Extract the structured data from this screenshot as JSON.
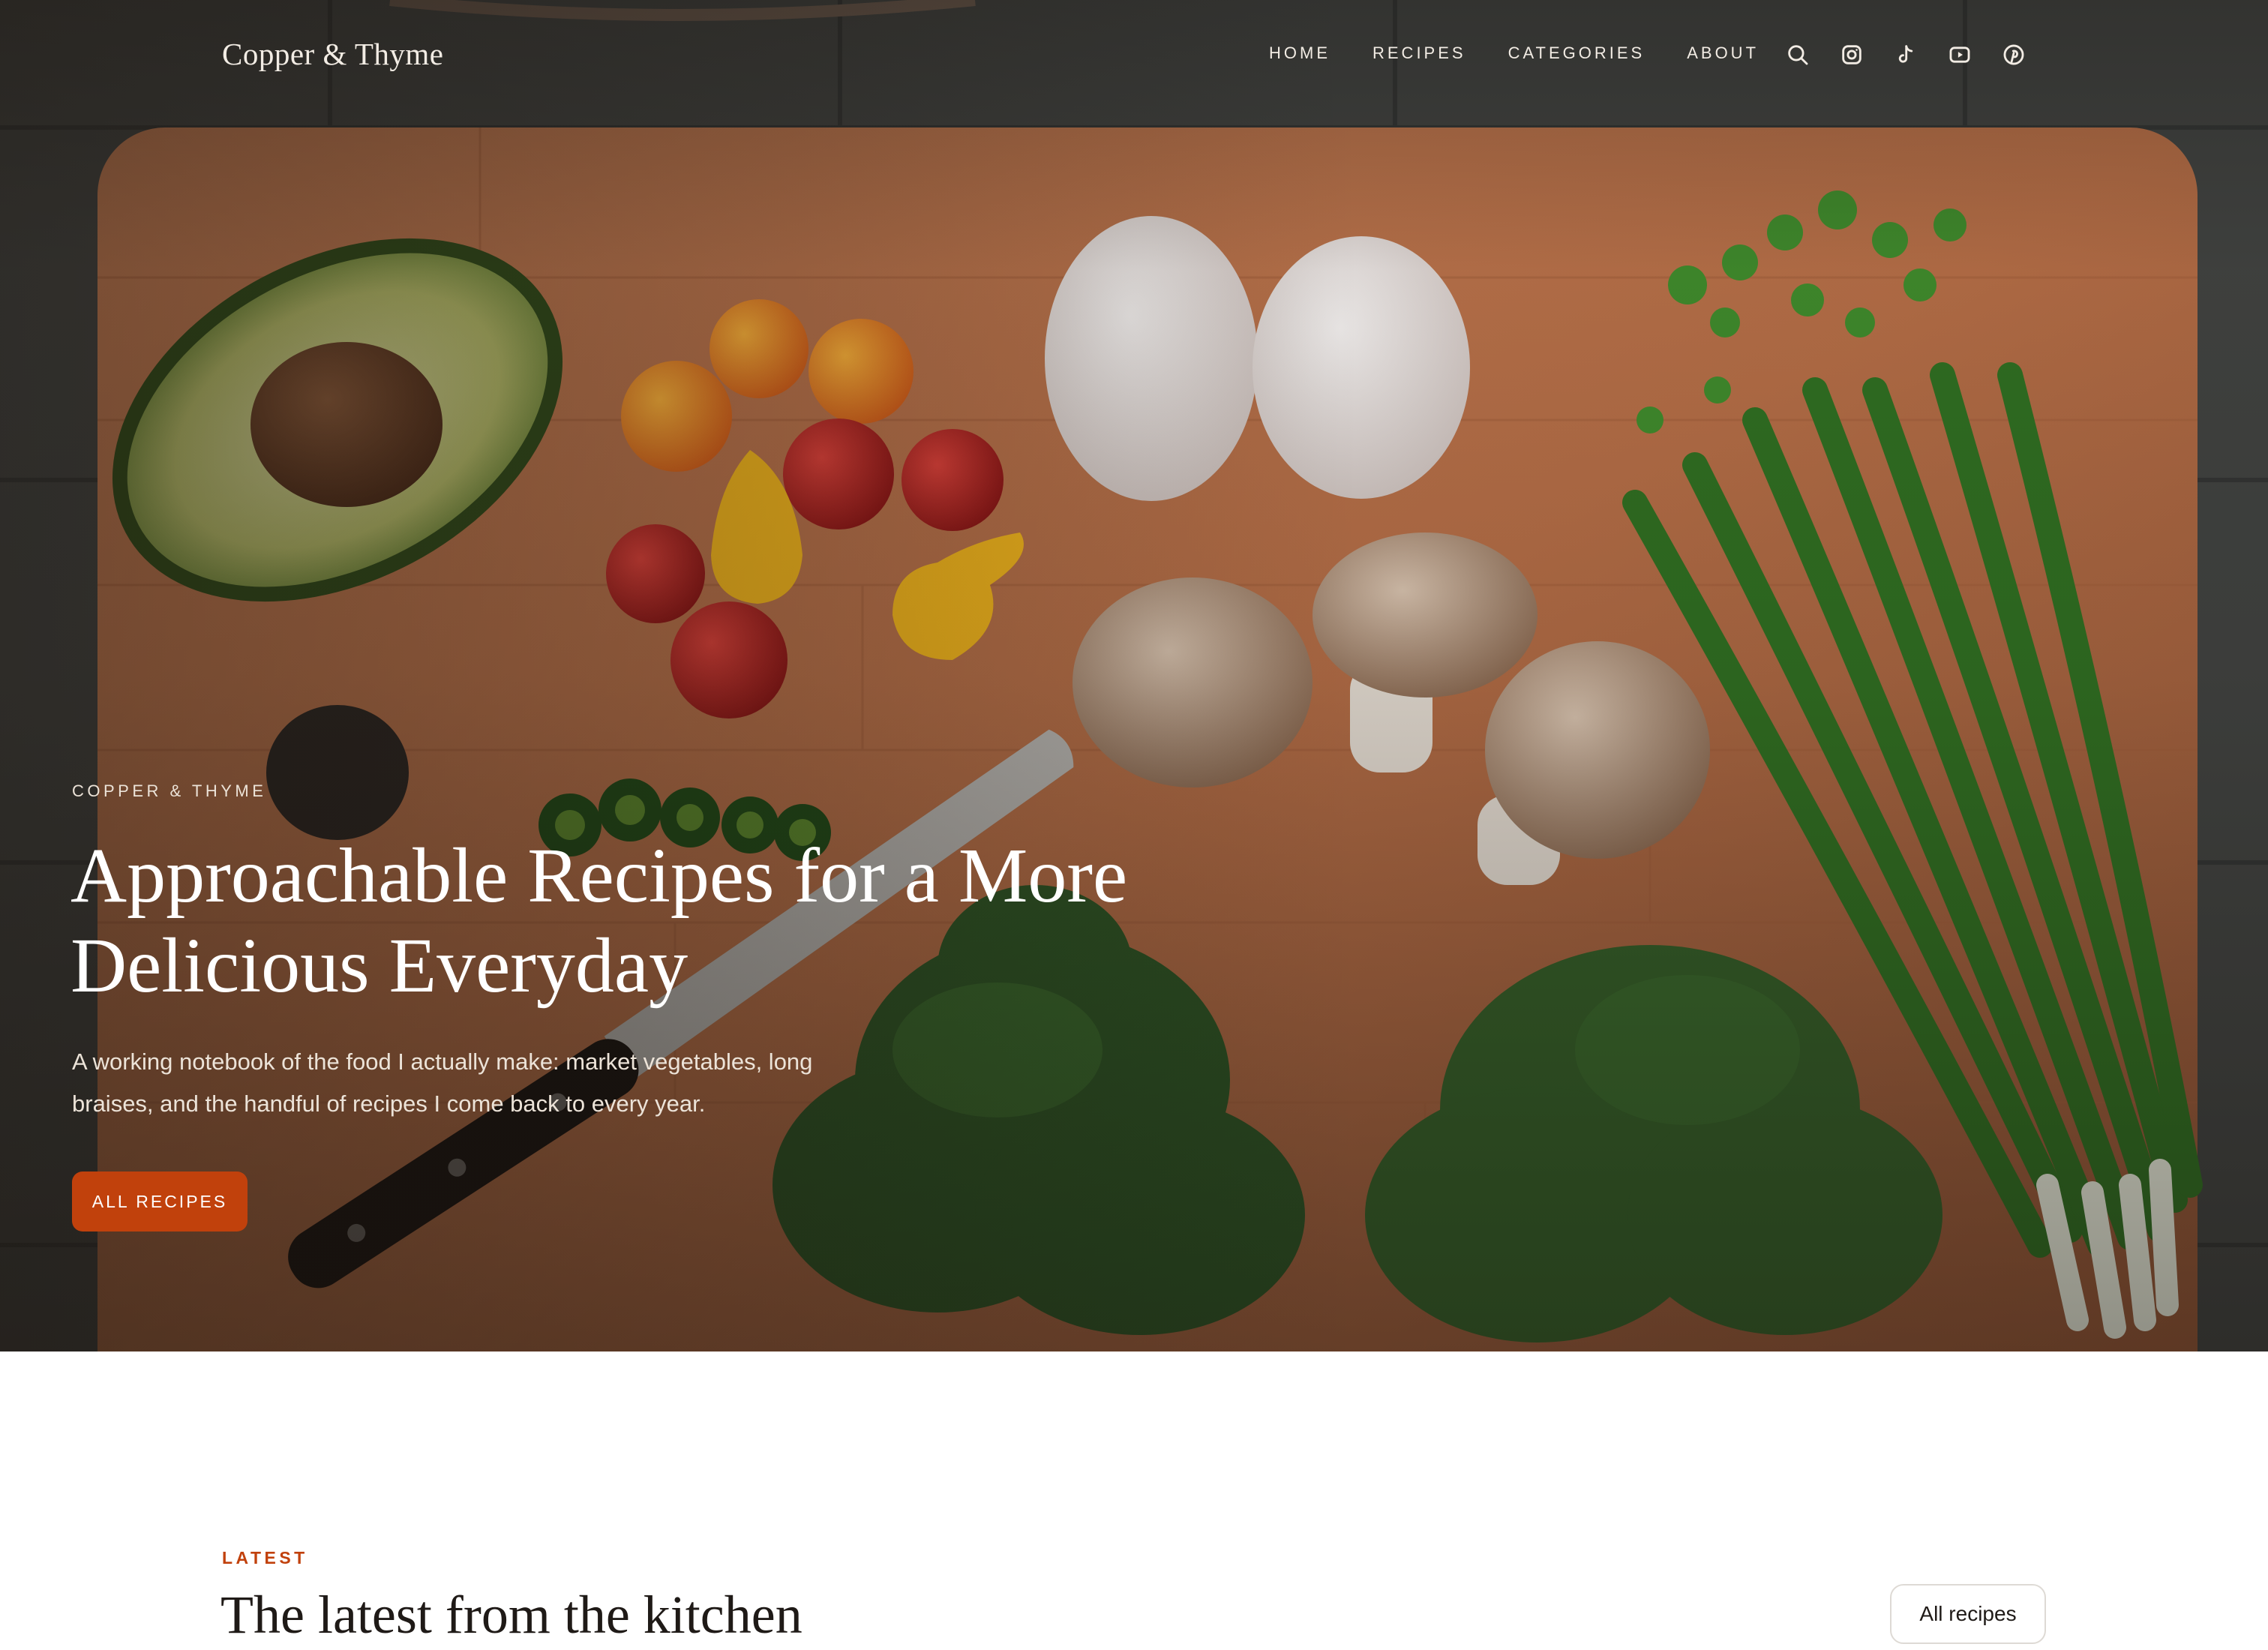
{
  "header": {
    "logo": "Copper & Thyme",
    "nav": [
      "HOME",
      "RECIPES",
      "CATEGORIES",
      "ABOUT"
    ],
    "icons": [
      "search-icon",
      "instagram-icon",
      "tiktok-icon",
      "youtube-icon",
      "pinterest-icon"
    ]
  },
  "hero": {
    "kicker": "COPPER & THYME",
    "title": "Approachable Recipes for a More Delicious Everyday",
    "subtitle": "A working notebook of the food I actually make: market vegetables, long braises, and the handful of recipes I come back to every year.",
    "cta": "ALL RECIPES"
  },
  "latest": {
    "label": "LATEST",
    "title": "The latest from the kitchen",
    "button": "All recipes"
  },
  "colors": {
    "accent": "#c1410c",
    "text_dark": "#1f1a17",
    "hero_text": "#f2ece4",
    "board": "#b9714a",
    "stone": "#3c3d3b"
  }
}
